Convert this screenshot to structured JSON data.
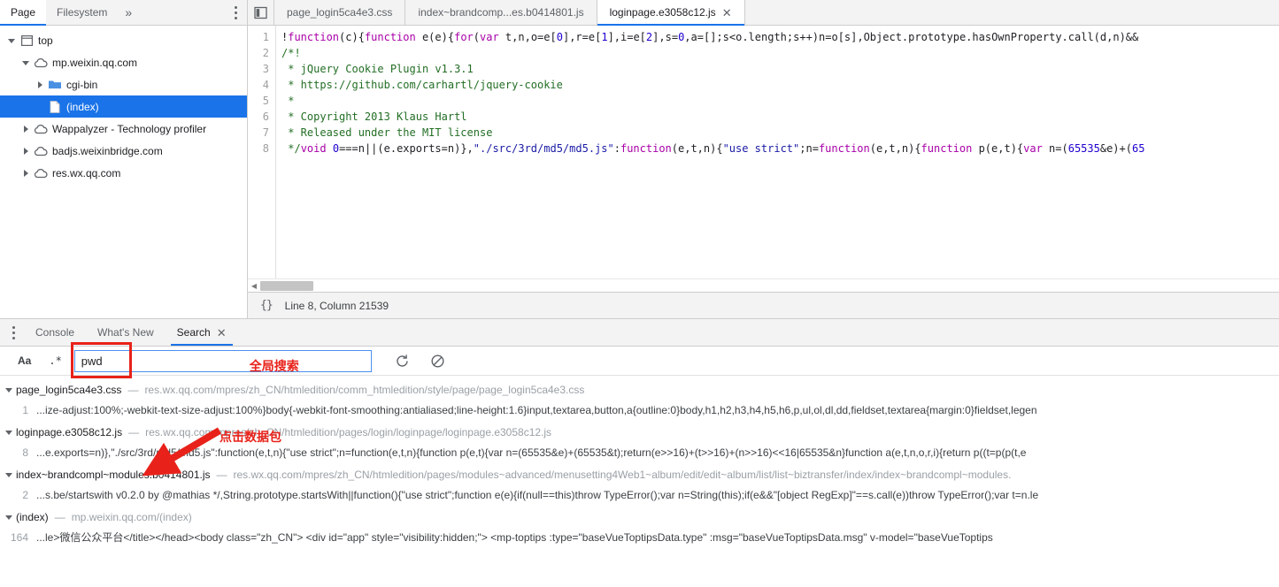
{
  "sidebar": {
    "tabs": [
      {
        "label": "Page",
        "active": true
      },
      {
        "label": "Filesystem",
        "active": false
      }
    ],
    "more_icon": "chevrons-right-icon",
    "kebab_icon": "more-options-icon",
    "tree": [
      {
        "label": "top",
        "icon": "frame-icon",
        "depth": 0,
        "arrow": "down",
        "selected": false
      },
      {
        "label": "mp.weixin.qq.com",
        "icon": "cloud-icon",
        "depth": 1,
        "arrow": "down",
        "selected": false
      },
      {
        "label": "cgi-bin",
        "icon": "folder-icon",
        "depth": 2,
        "arrow": "right",
        "selected": false
      },
      {
        "label": "(index)",
        "icon": "document-icon",
        "depth": 3,
        "arrow": "none",
        "selected": true
      },
      {
        "label": "Wappalyzer - Technology profiler",
        "icon": "cloud-icon",
        "depth": 1,
        "arrow": "right",
        "selected": false
      },
      {
        "label": "badjs.weixinbridge.com",
        "icon": "cloud-icon",
        "depth": 1,
        "arrow": "right",
        "selected": false
      },
      {
        "label": "res.wx.qq.com",
        "icon": "cloud-icon",
        "depth": 1,
        "arrow": "right",
        "selected": false
      }
    ]
  },
  "editor": {
    "panel_toggle_icon": "show-navigator-icon",
    "tabs": [
      {
        "label": "page_login5ca4e3.css",
        "active": false,
        "closable": false
      },
      {
        "label": "index~brandcomp...es.b0414801.js",
        "active": false,
        "closable": false
      },
      {
        "label": "loginpage.e3058c12.js",
        "active": true,
        "closable": true,
        "close_icon": "close-icon"
      }
    ],
    "line_numbers": [
      1,
      2,
      3,
      4,
      5,
      6,
      7,
      8
    ],
    "code": [
      [
        {
          "t": "!",
          "c": "p"
        },
        {
          "t": "function",
          "c": "k"
        },
        {
          "t": "(c){",
          "c": "p"
        },
        {
          "t": "function",
          "c": "k"
        },
        {
          "t": " e(e){",
          "c": "p"
        },
        {
          "t": "for",
          "c": "k"
        },
        {
          "t": "(",
          "c": "p"
        },
        {
          "t": "var",
          "c": "k"
        },
        {
          "t": " t,n,o=e[",
          "c": "p"
        },
        {
          "t": "0",
          "c": "n"
        },
        {
          "t": "],r=e[",
          "c": "p"
        },
        {
          "t": "1",
          "c": "n"
        },
        {
          "t": "],i=e[",
          "c": "p"
        },
        {
          "t": "2",
          "c": "n"
        },
        {
          "t": "],s=",
          "c": "p"
        },
        {
          "t": "0",
          "c": "n"
        },
        {
          "t": ",a=[];s<o.length;s++)n=o[s],Object.prototype.hasOwnProperty.call(d,n)&&",
          "c": "p"
        }
      ],
      [
        {
          "t": "/*!",
          "c": "c"
        }
      ],
      [
        {
          "t": " * jQuery Cookie Plugin v1.3.1",
          "c": "c"
        }
      ],
      [
        {
          "t": " * https://github.com/carhartl/jquery-cookie",
          "c": "c"
        }
      ],
      [
        {
          "t": " *",
          "c": "c"
        }
      ],
      [
        {
          "t": " * Copyright 2013 Klaus Hartl",
          "c": "c"
        }
      ],
      [
        {
          "t": " * Released under the MIT license",
          "c": "c"
        }
      ],
      [
        {
          "t": " */",
          "c": "c"
        },
        {
          "t": "void",
          "c": "k"
        },
        {
          "t": " ",
          "c": "p"
        },
        {
          "t": "0",
          "c": "n"
        },
        {
          "t": "===n||(e.exports=n)},",
          "c": "p"
        },
        {
          "t": "\"./src/3rd/md5/md5.js\"",
          "c": "s"
        },
        {
          "t": ":",
          "c": "p"
        },
        {
          "t": "function",
          "c": "k"
        },
        {
          "t": "(e,t,n){",
          "c": "p"
        },
        {
          "t": "\"use strict\"",
          "c": "s"
        },
        {
          "t": ";n=",
          "c": "p"
        },
        {
          "t": "function",
          "c": "k"
        },
        {
          "t": "(e,t,n){",
          "c": "p"
        },
        {
          "t": "function",
          "c": "k"
        },
        {
          "t": " p(e,t){",
          "c": "p"
        },
        {
          "t": "var",
          "c": "k"
        },
        {
          "t": " n=(",
          "c": "p"
        },
        {
          "t": "65535",
          "c": "n"
        },
        {
          "t": "&e)+(",
          "c": "p"
        },
        {
          "t": "65",
          "c": "n"
        }
      ]
    ],
    "hscroll_arrow_icon": "scroll-left-icon",
    "status": {
      "prettyprint_icon": "pretty-print-icon",
      "prettyprint_label": "{}",
      "position": "Line 8, Column 21539"
    }
  },
  "drawer": {
    "kebab_icon": "more-tools-icon",
    "tabs": [
      {
        "label": "Console",
        "active": false,
        "closable": false
      },
      {
        "label": "What's New",
        "active": false,
        "closable": false
      },
      {
        "label": "Search",
        "active": true,
        "closable": true,
        "close_icon": "close-icon"
      }
    ],
    "search": {
      "match_case_label": "Aa",
      "match_case_name": "match-case-icon",
      "regex_label": ".*",
      "regex_name": "use-regex-icon",
      "query": "pwd",
      "placeholder": "",
      "refresh_icon": "refresh-icon",
      "clear_icon": "clear-icon",
      "annotation_text": "全局搜索",
      "annotation_color": "#e8221a"
    },
    "arrow_annotation": {
      "text": "点击数据包",
      "color": "#e8221a"
    },
    "results": [
      {
        "file": "page_login5ca4e3.css",
        "dash": "—",
        "url": "res.wx.qq.com/mpres/zh_CN/htmledition/comm_htmledition/style/page/page_login5ca4e3.css",
        "matches": [
          {
            "line": "1",
            "text": "...ize-adjust:100%;-webkit-text-size-adjust:100%}body{-webkit-font-smoothing:antialiased;line-height:1.6}input,textarea,button,a{outline:0}body,h1,h2,h3,h4,h5,h6,p,ul,ol,dl,dd,fieldset,textarea{margin:0}fieldset,legen"
          }
        ]
      },
      {
        "file": "loginpage.e3058c12.js",
        "dash": "—",
        "url": "res.wx.qq.com/mpres/zh_CN/htmledition/pages/login/loginpage/loginpage.e3058c12.js",
        "matches": [
          {
            "line": "8",
            "text": "...e.exports=n)},\"./src/3rd/md5/md5.js\":function(e,t,n){\"use strict\";n=function(e,t,n){function p(e,t){var n=(65535&e)+(65535&t);return(e>>16)+(t>>16)+(n>>16)<<16|65535&n}function a(e,t,n,o,r,i){return p((t=p(p(t,e"
          }
        ]
      },
      {
        "file": "index~brandcompl~modules.b0414801.js",
        "dash": "—",
        "url": "res.wx.qq.com/mpres/zh_CN/htmledition/pages/modules~advanced/menusetting4Web1~album/edit/edit~album/list/list~biztransfer/index/index~brandcompl~modules.",
        "matches": [
          {
            "line": "2",
            "text": "...s.be/startswith v0.2.0 by @mathias */,String.prototype.startsWith||function(){\"use strict\";function e(e){if(null==this)throw TypeError();var n=String(this);if(e&&\"[object RegExp]\"==s.call(e))throw TypeError();var t=n.le"
          }
        ]
      },
      {
        "file": "(index)",
        "dash": "—",
        "url": "mp.weixin.qq.com/(index)",
        "matches": [
          {
            "line": "164",
            "text": "...le>微信公众平台</title></head><body class=\"zh_CN\">  <div id=\"app\" style=\"visibility:hidden;\">    <mp-toptips :type=\"baseVueToptipsData.type\" :msg=\"baseVueToptipsData.msg\" v-model=\"baseVueToptips"
          }
        ]
      }
    ]
  },
  "colors": {
    "accent": "#1a73e8",
    "selection": "#1a73e8",
    "annotation_red": "#e8221a",
    "toolbar_bg": "#f3f3f3"
  }
}
